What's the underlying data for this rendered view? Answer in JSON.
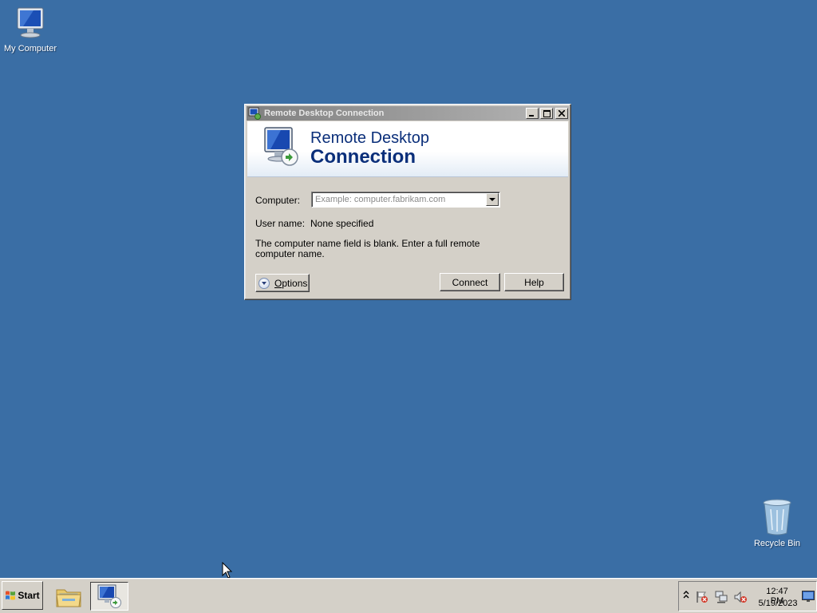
{
  "desktop": {
    "icons": [
      {
        "label": "My Computer"
      },
      {
        "label": "Recycle Bin"
      }
    ]
  },
  "dialog": {
    "title": "Remote Desktop Connection",
    "banner_line1": "Remote Desktop",
    "banner_line2": "Connection",
    "computer_label": "Computer:",
    "computer_value": "",
    "computer_placeholder": "Example: computer.fabrikam.com",
    "username_label": "User name:",
    "username_value": "None specified",
    "hint": "The computer name field is blank. Enter a full remote computer name.",
    "options_label_mnemonic": "O",
    "options_label_rest": "ptions",
    "connect_label": "Connect",
    "help_label": "Help"
  },
  "taskbar": {
    "start_label": "Start",
    "clock_time": "12:47 PM",
    "clock_date": "5/19/2023"
  },
  "colors": {
    "desktop_bg": "#3a6ea5",
    "title_text": "#0b2f7a",
    "chrome": "#d4d0c8"
  }
}
